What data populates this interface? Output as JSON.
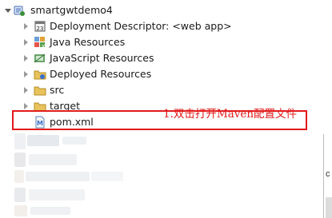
{
  "project": {
    "name": "smartgwtdemo4",
    "children": [
      {
        "label": "Deployment Descriptor: <web app>",
        "icon": "deployment-descriptor-icon"
      },
      {
        "label": "Java Resources",
        "icon": "java-resources-icon"
      },
      {
        "label": "JavaScript Resources",
        "icon": "javascript-resources-icon"
      },
      {
        "label": "Deployed Resources",
        "icon": "deployed-resources-icon"
      },
      {
        "label": "src",
        "icon": "folder-icon"
      },
      {
        "label": "target",
        "icon": "folder-icon"
      },
      {
        "label": "pom.xml",
        "icon": "xml-file-icon"
      }
    ]
  },
  "annotation": "1.双击打开Maven配置文件",
  "edge_text": "c",
  "colors": {
    "highlight": "#e21b1b",
    "folder": "#e8c25a",
    "accent_blue": "#3b6fc9"
  }
}
